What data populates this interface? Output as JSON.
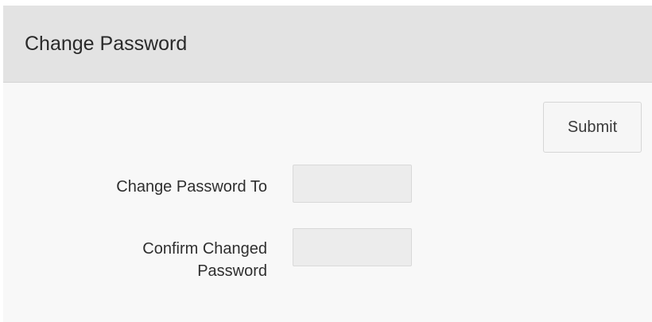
{
  "header": {
    "title": "Change Password"
  },
  "actions": {
    "submit_label": "Submit"
  },
  "form": {
    "fields": [
      {
        "label": "Change Password To",
        "value": "",
        "placeholder": ""
      },
      {
        "label_lines": [
          "Confirm Changed",
          "Password"
        ],
        "value": "",
        "placeholder": ""
      }
    ]
  },
  "colors": {
    "header_background": "#e3e3e3",
    "panel_background": "#f8f8f8",
    "input_background": "#ececec",
    "button_background": "#f6f6f6"
  }
}
